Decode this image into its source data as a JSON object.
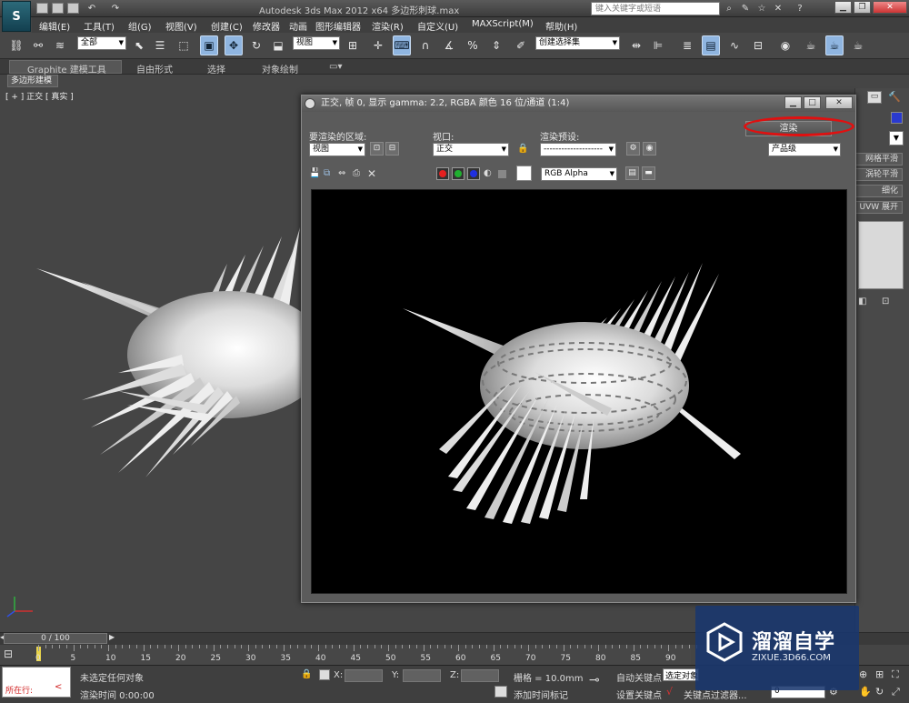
{
  "app": {
    "logo_text": "S",
    "window_title": "Autodesk 3ds Max  2012 x64      多边形刺球.max",
    "search_placeholder": "键入关键字或短语"
  },
  "menu": {
    "items": [
      "编辑(E)",
      "工具(T)",
      "组(G)",
      "视图(V)",
      "创建(C)",
      "修改器",
      "动画",
      "图形编辑器",
      "渲染(R)",
      "自定义(U)",
      "MAXScript(M)",
      "帮助(H)"
    ]
  },
  "toolbar": {
    "filter_select": "全部",
    "coord_select": "视图",
    "named_selection": "创建选择集"
  },
  "ribbon": {
    "tabs": [
      "Graphite 建模工具",
      "自由形式",
      "选择",
      "对象绘制"
    ],
    "subtab": "多边形建模"
  },
  "viewport": {
    "label": "[ + ]  正交  [ 真实 ]"
  },
  "command_panel": {
    "items": [
      "网格平滑",
      "涡轮平滑",
      "细化",
      "UVW 展开"
    ]
  },
  "render_frame": {
    "title": "正交, 帧 0, 显示 gamma: 2.2, RGBA 颜色 16 位/通道 (1:4)",
    "area_label": "要渲染的区域:",
    "area_value": "视图",
    "viewport_label": "视口:",
    "viewport_value": "正交",
    "preset_label": "渲染预设:",
    "preset_value": "--------------------",
    "render_button": "渲染",
    "quality_value": "产品级",
    "channel_value": "RGB Alpha"
  },
  "timeline": {
    "frame_display": "0 / 100",
    "ticks": [
      "0",
      "5",
      "10",
      "15",
      "20",
      "25",
      "30",
      "35",
      "40",
      "45",
      "50",
      "55",
      "60",
      "65",
      "70",
      "75",
      "80",
      "85",
      "90"
    ]
  },
  "status": {
    "script_label": "所在行:",
    "selection_status": "未选定任何对象",
    "render_time": "渲染时间  0:00:00",
    "x_label": "X:",
    "y_label": "Y:",
    "z_label": "Z:",
    "grid": "栅格 = 10.0mm",
    "add_tag": "添加时间标记",
    "auto_key": "自动关键点",
    "selected_obj": "选定对象",
    "set_key": "设置关键点",
    "key_filters": "关键点过滤器...",
    "frame_value": "0"
  },
  "watermark": {
    "main": "溜溜自学",
    "sub": "ZIXUE.3D66.COM"
  },
  "colors": {
    "accent_blue": "#8fb5e0",
    "highlight_red": "#e01010",
    "watermark_bg": "#19376e"
  }
}
